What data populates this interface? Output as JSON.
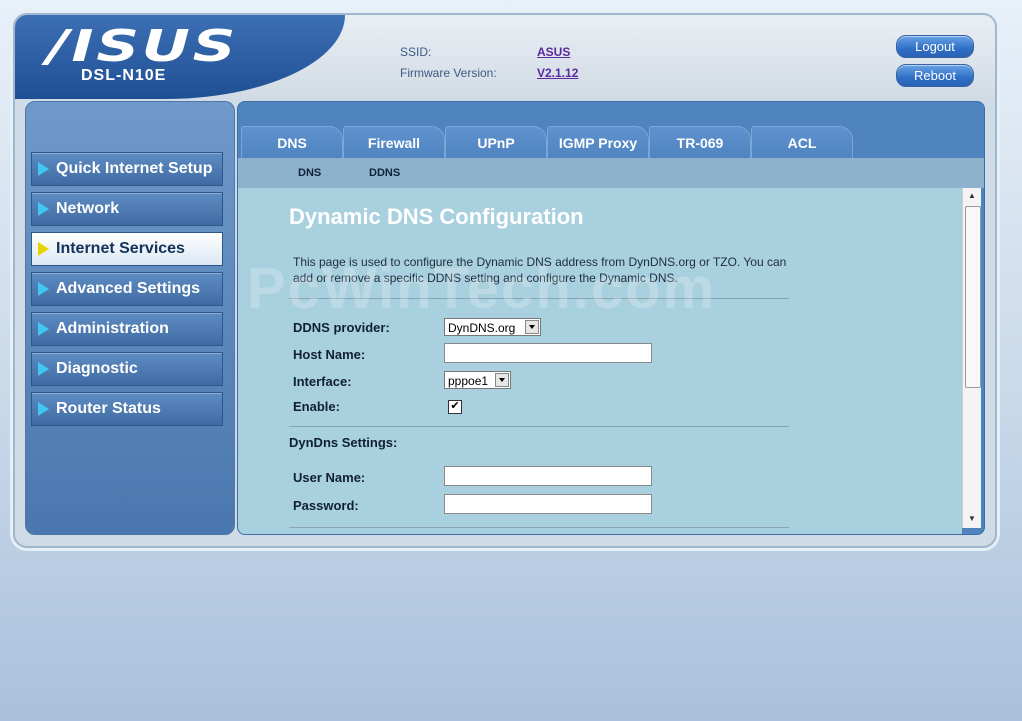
{
  "brand": {
    "logo": "/ISUS",
    "model": "DSL-N10E"
  },
  "info": {
    "ssid_label": "SSID:",
    "ssid_value": "ASUS",
    "fw_label": "Firmware Version:",
    "fw_value": "V2.1.12"
  },
  "header_buttons": {
    "logout": "Logout",
    "reboot": "Reboot"
  },
  "sidebar": {
    "items": [
      {
        "label": "Quick Internet Setup"
      },
      {
        "label": "Network"
      },
      {
        "label": "Internet Services",
        "active": true
      },
      {
        "label": "Advanced Settings"
      },
      {
        "label": "Administration"
      },
      {
        "label": "Diagnostic"
      },
      {
        "label": "Router Status"
      }
    ]
  },
  "tabs": [
    "DNS",
    "Firewall",
    "UPnP",
    "IGMP Proxy",
    "TR-069",
    "ACL"
  ],
  "subtabs": [
    "DNS",
    "DDNS"
  ],
  "content": {
    "title": "Dynamic DNS Configuration",
    "description": "This page is used to configure the Dynamic DNS address from DynDNS.org or TZO. You can add or remove a specific DDNS setting and configure the Dynamic DNS.",
    "watermark": "PcWinTech.com"
  },
  "form": {
    "ddns_provider_label": "DDNS provider:",
    "ddns_provider_value": "DynDNS.org",
    "host_name_label": "Host Name:",
    "host_name_value": "",
    "interface_label": "Interface:",
    "interface_value": "pppoe1",
    "enable_label": "Enable:",
    "enable_checked": "✔",
    "dyndns_settings_label": "DynDns Settings:",
    "user_name_label": "User Name:",
    "user_name_value": "",
    "password_label": "Password:",
    "password_value": ""
  },
  "colors": {
    "accent": "#4f84bf",
    "content_bg": "#a8d0de",
    "active_arrow": "#e8d400",
    "arrow": "#3fc9f2"
  }
}
